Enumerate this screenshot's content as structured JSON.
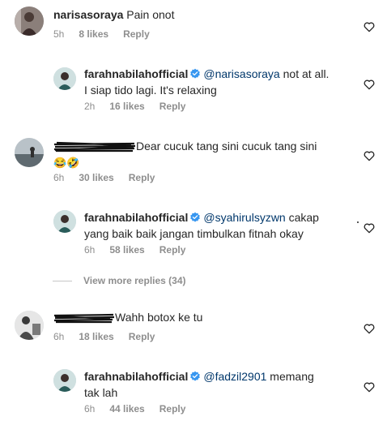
{
  "comments": [
    {
      "username": "narisasoraya",
      "text": "Pain onot",
      "time": "5h",
      "likes": "8 likes",
      "reply": "Reply"
    },
    {
      "username": "farahnabilahofficial",
      "mention": "@narisasoraya",
      "text_line1": " not at all.",
      "text_line2": "I siap tido lagi. It's relaxing",
      "time": "2h",
      "likes": "16 likes",
      "reply": "Reply"
    },
    {
      "username_redacted": true,
      "text": "Dear cucuk tang sini cucuk tang sini",
      "emoji": "😂🤣",
      "time": "6h",
      "likes": "30 likes",
      "reply": "Reply"
    },
    {
      "username": "farahnabilahofficial",
      "mention": "@syahirulsyzwn",
      "text_line1": " cakap",
      "text_line2": "yang baik baik jangan timbulkan fitnah okay",
      "time": "6h",
      "likes": "58 likes",
      "reply": "Reply"
    },
    {
      "username_redacted": true,
      "text": "Wahh botox ke tu",
      "time": "6h",
      "likes": "18 likes",
      "reply": "Reply"
    },
    {
      "username": "farahnabilahofficial",
      "mention": "@fadzil2901",
      "text_line1": " memang",
      "text_line2": "tak lah",
      "time": "6h",
      "likes": "44 likes",
      "reply": "Reply"
    }
  ],
  "view_more_replies": "View more replies (34)",
  "icons": {
    "like": "heart-outline-icon",
    "verified": "verified-badge-icon"
  },
  "colors": {
    "secondary_text": "#8e8e8e",
    "mention": "#00376b",
    "verified": "#3897f0"
  }
}
